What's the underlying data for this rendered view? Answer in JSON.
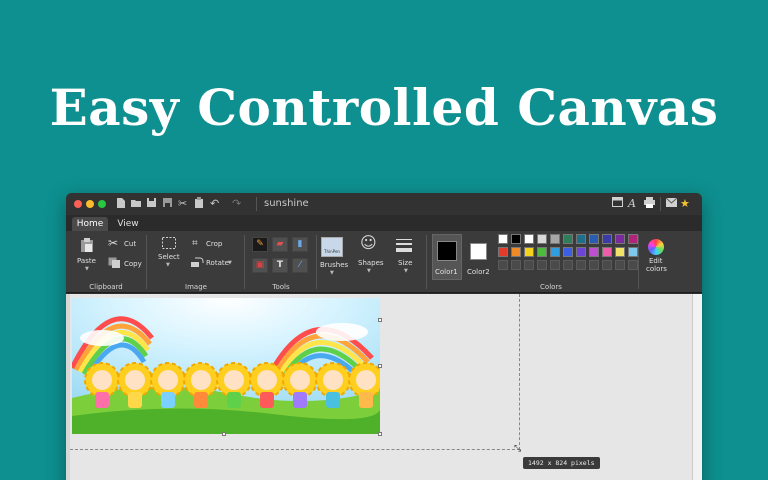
{
  "headline": "Easy Controlled Canvas",
  "window": {
    "document_title": "sunshine",
    "tabs": [
      {
        "label": "Home",
        "active": true
      },
      {
        "label": "View",
        "active": false
      }
    ]
  },
  "ribbon": {
    "clipboard": {
      "group_label": "Clipboard",
      "paste": "Paste",
      "cut": "Cut",
      "copy": "Copy"
    },
    "image": {
      "group_label": "Image",
      "select": "Select",
      "crop": "Crop",
      "rotate": "Rotate"
    },
    "tools": {
      "group_label": "Tools"
    },
    "brushes": {
      "label": "Brushes",
      "preview_text": "ThinPen"
    },
    "shapes": {
      "label": "Shapes"
    },
    "size": {
      "label": "Size"
    },
    "color1": {
      "label": "Color1",
      "value": "#000000"
    },
    "color2": {
      "label": "Color2",
      "value": "#ffffff"
    },
    "colors": {
      "group_label": "Colors",
      "palette_row1": [
        "#ffffff",
        "#000000",
        "#ffffff",
        "#d9d9d9",
        "#a6a6a6",
        "#2e7d5b",
        "#1f6e8c",
        "#2a5db0",
        "#3a3aa8",
        "#7a2a9c",
        "#b0257a"
      ],
      "palette_row2": [
        "#e23b2b",
        "#f08a24",
        "#f2d21c",
        "#4cbb3d",
        "#2f9de0",
        "#3b5fe3",
        "#6e44d8",
        "#c04ed0",
        "#ef5da8",
        "#f2e26a",
        "#7ec8f0"
      ]
    },
    "edit_colors": {
      "label": "Edit colors"
    }
  },
  "status": {
    "canvas_size": "1492 x 824 pixels"
  }
}
